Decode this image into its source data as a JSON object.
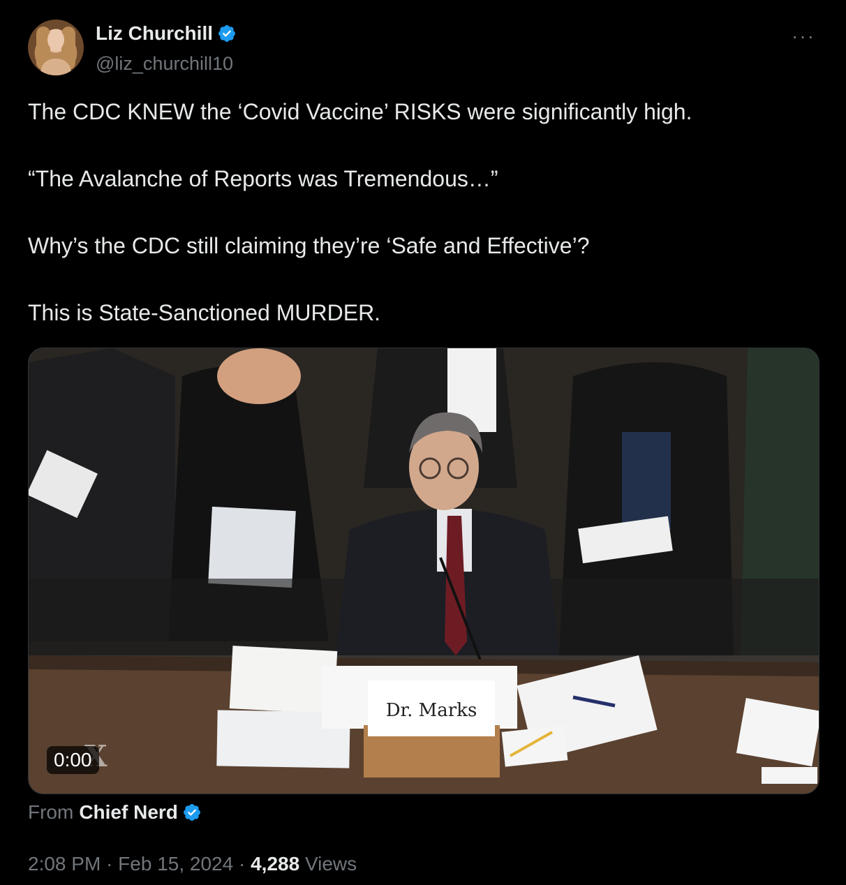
{
  "author": {
    "name": "Liz Churchill",
    "handle": "@liz_churchill10",
    "verified": true
  },
  "more_icon": "more-horizontal-icon",
  "tweet_lines": [
    "The CDC KNEW the ‘Covid Vaccine’ RISKS were significantly high.",
    "“The Avalanche of Reports was Tremendous…”",
    "Why’s the CDC still claiming they’re ‘Safe and Effective’?",
    "This is State-Sanctioned MURDER."
  ],
  "video": {
    "duration": "0:00",
    "nameplate": "Dr. Marks"
  },
  "source": {
    "label": "From",
    "name": "Chief Nerd",
    "verified": true
  },
  "meta": {
    "time": "2:08 PM",
    "date": "Feb 15, 2024",
    "views_count": "4,288",
    "views_label": "Views"
  },
  "colors": {
    "background": "#000000",
    "text": "#e7e9ea",
    "muted": "#71767b",
    "verified": "#1d9bf0"
  }
}
